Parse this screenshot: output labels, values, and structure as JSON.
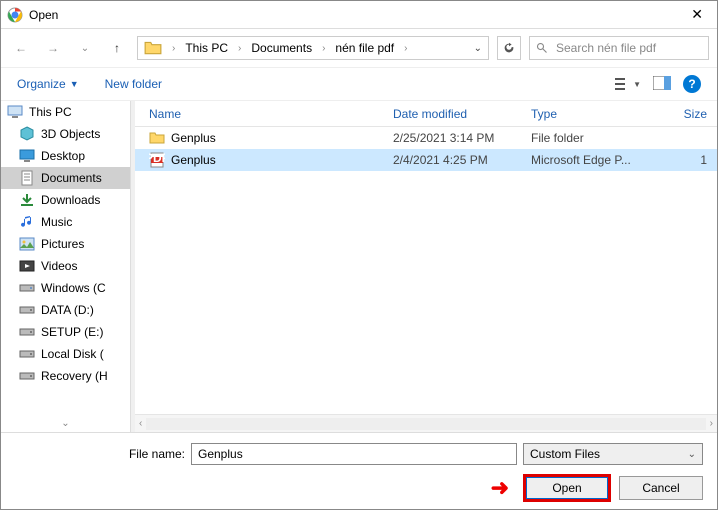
{
  "title": "Open",
  "breadcrumb": {
    "parts": [
      "This PC",
      "Documents",
      "nén file pdf"
    ]
  },
  "search": {
    "placeholder": "Search nén file pdf"
  },
  "toolbar": {
    "organize": "Organize",
    "newfolder": "New folder"
  },
  "sidebar": {
    "root": "This PC",
    "items": [
      "3D Objects",
      "Desktop",
      "Documents",
      "Downloads",
      "Music",
      "Pictures",
      "Videos",
      "Windows (C",
      "DATA (D:)",
      "SETUP (E:)",
      "Local Disk (",
      "Recovery (H"
    ]
  },
  "columns": {
    "name": "Name",
    "date": "Date modified",
    "type": "Type",
    "size": "Size"
  },
  "rows": [
    {
      "name": "Genplus",
      "date": "2/25/2021 3:14 PM",
      "type": "File folder",
      "size": "",
      "icon": "folder",
      "selected": false
    },
    {
      "name": "Genplus",
      "date": "2/4/2021 4:25 PM",
      "type": "Microsoft Edge P...",
      "size": "1",
      "icon": "pdf",
      "selected": true
    }
  ],
  "filename": {
    "label": "File name:",
    "value": "Genplus"
  },
  "filetype": "Custom Files",
  "buttons": {
    "open": "Open",
    "cancel": "Cancel"
  }
}
